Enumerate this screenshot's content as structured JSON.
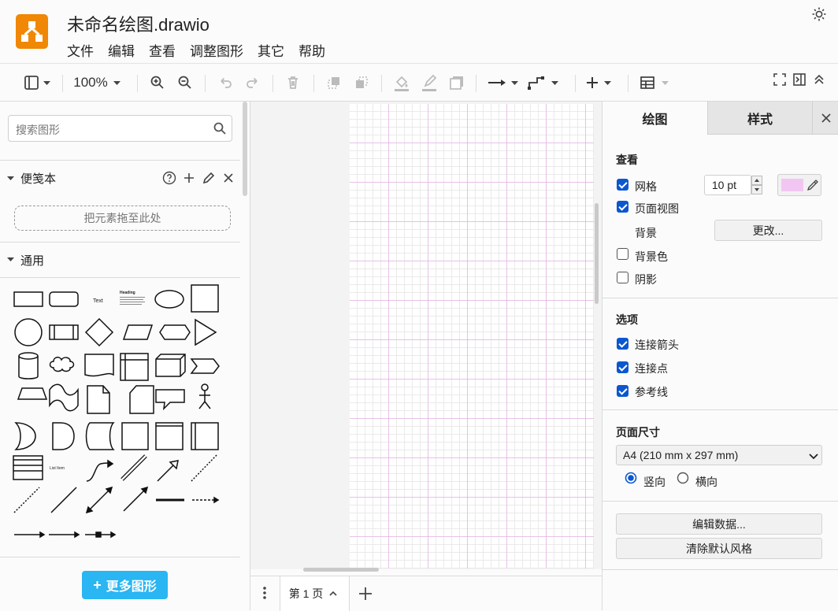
{
  "app": {
    "title": "未命名绘图.drawio",
    "menu": [
      "文件",
      "编辑",
      "查看",
      "调整图形",
      "其它",
      "帮助"
    ]
  },
  "toolbar": {
    "zoom": "100%"
  },
  "sidebar": {
    "search_placeholder": "搜索图形",
    "scratchpad_title": "便笺本",
    "dropzone_text": "把元素拖至此处",
    "general_title": "通用",
    "shape_text_label": "Text",
    "shape_heading_label": "Heading",
    "shape_listitem_label": "List Item",
    "more_shapes": "更多图形"
  },
  "pages": {
    "current": "第 1 页"
  },
  "format_panel": {
    "tabs": [
      "绘图",
      "样式"
    ],
    "view_section": "查看",
    "grid_label": "网格",
    "grid_checked": true,
    "grid_size": "10 pt",
    "grid_color": "#f2c6f2",
    "page_view_label": "页面视图",
    "page_view_checked": true,
    "background_label": "背景",
    "change_button": "更改...",
    "bg_color_label": "背景色",
    "bg_color_checked": false,
    "shadow_label": "阴影",
    "shadow_checked": false,
    "options_section": "选项",
    "connection_arrows_label": "连接箭头",
    "connection_points_label": "连接点",
    "guides_label": "参考线",
    "paper_size_section": "页面尺寸",
    "paper_size_value": "A4 (210 mm x 297 mm)",
    "orientation_portrait": "竖向",
    "orientation_landscape": "横向",
    "orientation_selected": "portrait",
    "edit_data_button": "编辑数据...",
    "clear_style_button": "清除默认风格"
  },
  "colors": {
    "accent": "#0b57d0",
    "logo": "#f08705",
    "more_shapes_button": "#29b6f2"
  }
}
